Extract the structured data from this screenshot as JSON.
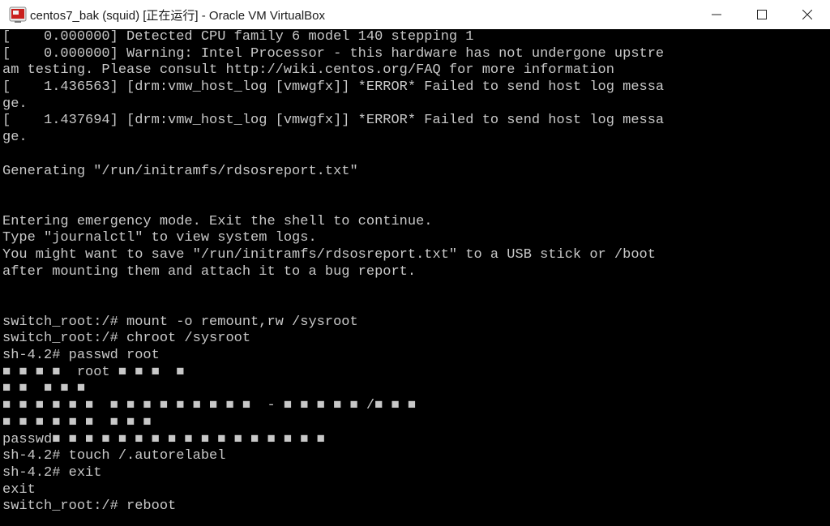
{
  "window": {
    "title": "centos7_bak (squid) [正在运行] - Oracle VM VirtualBox",
    "icon": "virtualbox-app-icon",
    "controls": [
      "minimize",
      "maximize",
      "close"
    ]
  },
  "console": {
    "lines": [
      "[    0.000000] Detected CPU family 6 model 140 stepping 1",
      "[    0.000000] Warning: Intel Processor - this hardware has not undergone upstre",
      "am testing. Please consult http://wiki.centos.org/FAQ for more information",
      "[    1.436563] [drm:vmw_host_log [vmwgfx]] *ERROR* Failed to send host log messa",
      "ge.",
      "[    1.437694] [drm:vmw_host_log [vmwgfx]] *ERROR* Failed to send host log messa",
      "ge.",
      "",
      "Generating \"/run/initramfs/rdsosreport.txt\"",
      "",
      "",
      "Entering emergency mode. Exit the shell to continue.",
      "Type \"journalctl\" to view system logs.",
      "You might want to save \"/run/initramfs/rdsosreport.txt\" to a USB stick or /boot",
      "after mounting them and attach it to a bug report.",
      "",
      "",
      "switch_root:/# mount -o remount,rw /sysroot",
      "switch_root:/# chroot /sysroot",
      "sh-4.2# passwd root",
      "■ ■ ■ ■  root ■ ■ ■  ■",
      "■ ■  ■ ■ ■",
      "■ ■ ■ ■ ■ ■  ■ ■ ■ ■ ■ ■ ■ ■ ■  - ■ ■ ■ ■ ■ /■ ■ ■",
      "■ ■ ■ ■ ■ ■  ■ ■ ■",
      "passwd■ ■ ■ ■ ■ ■ ■ ■ ■ ■ ■ ■ ■ ■ ■ ■ ■",
      "sh-4.2# touch /.autorelabel",
      "sh-4.2# exit",
      "exit",
      "switch_root:/# reboot"
    ]
  }
}
